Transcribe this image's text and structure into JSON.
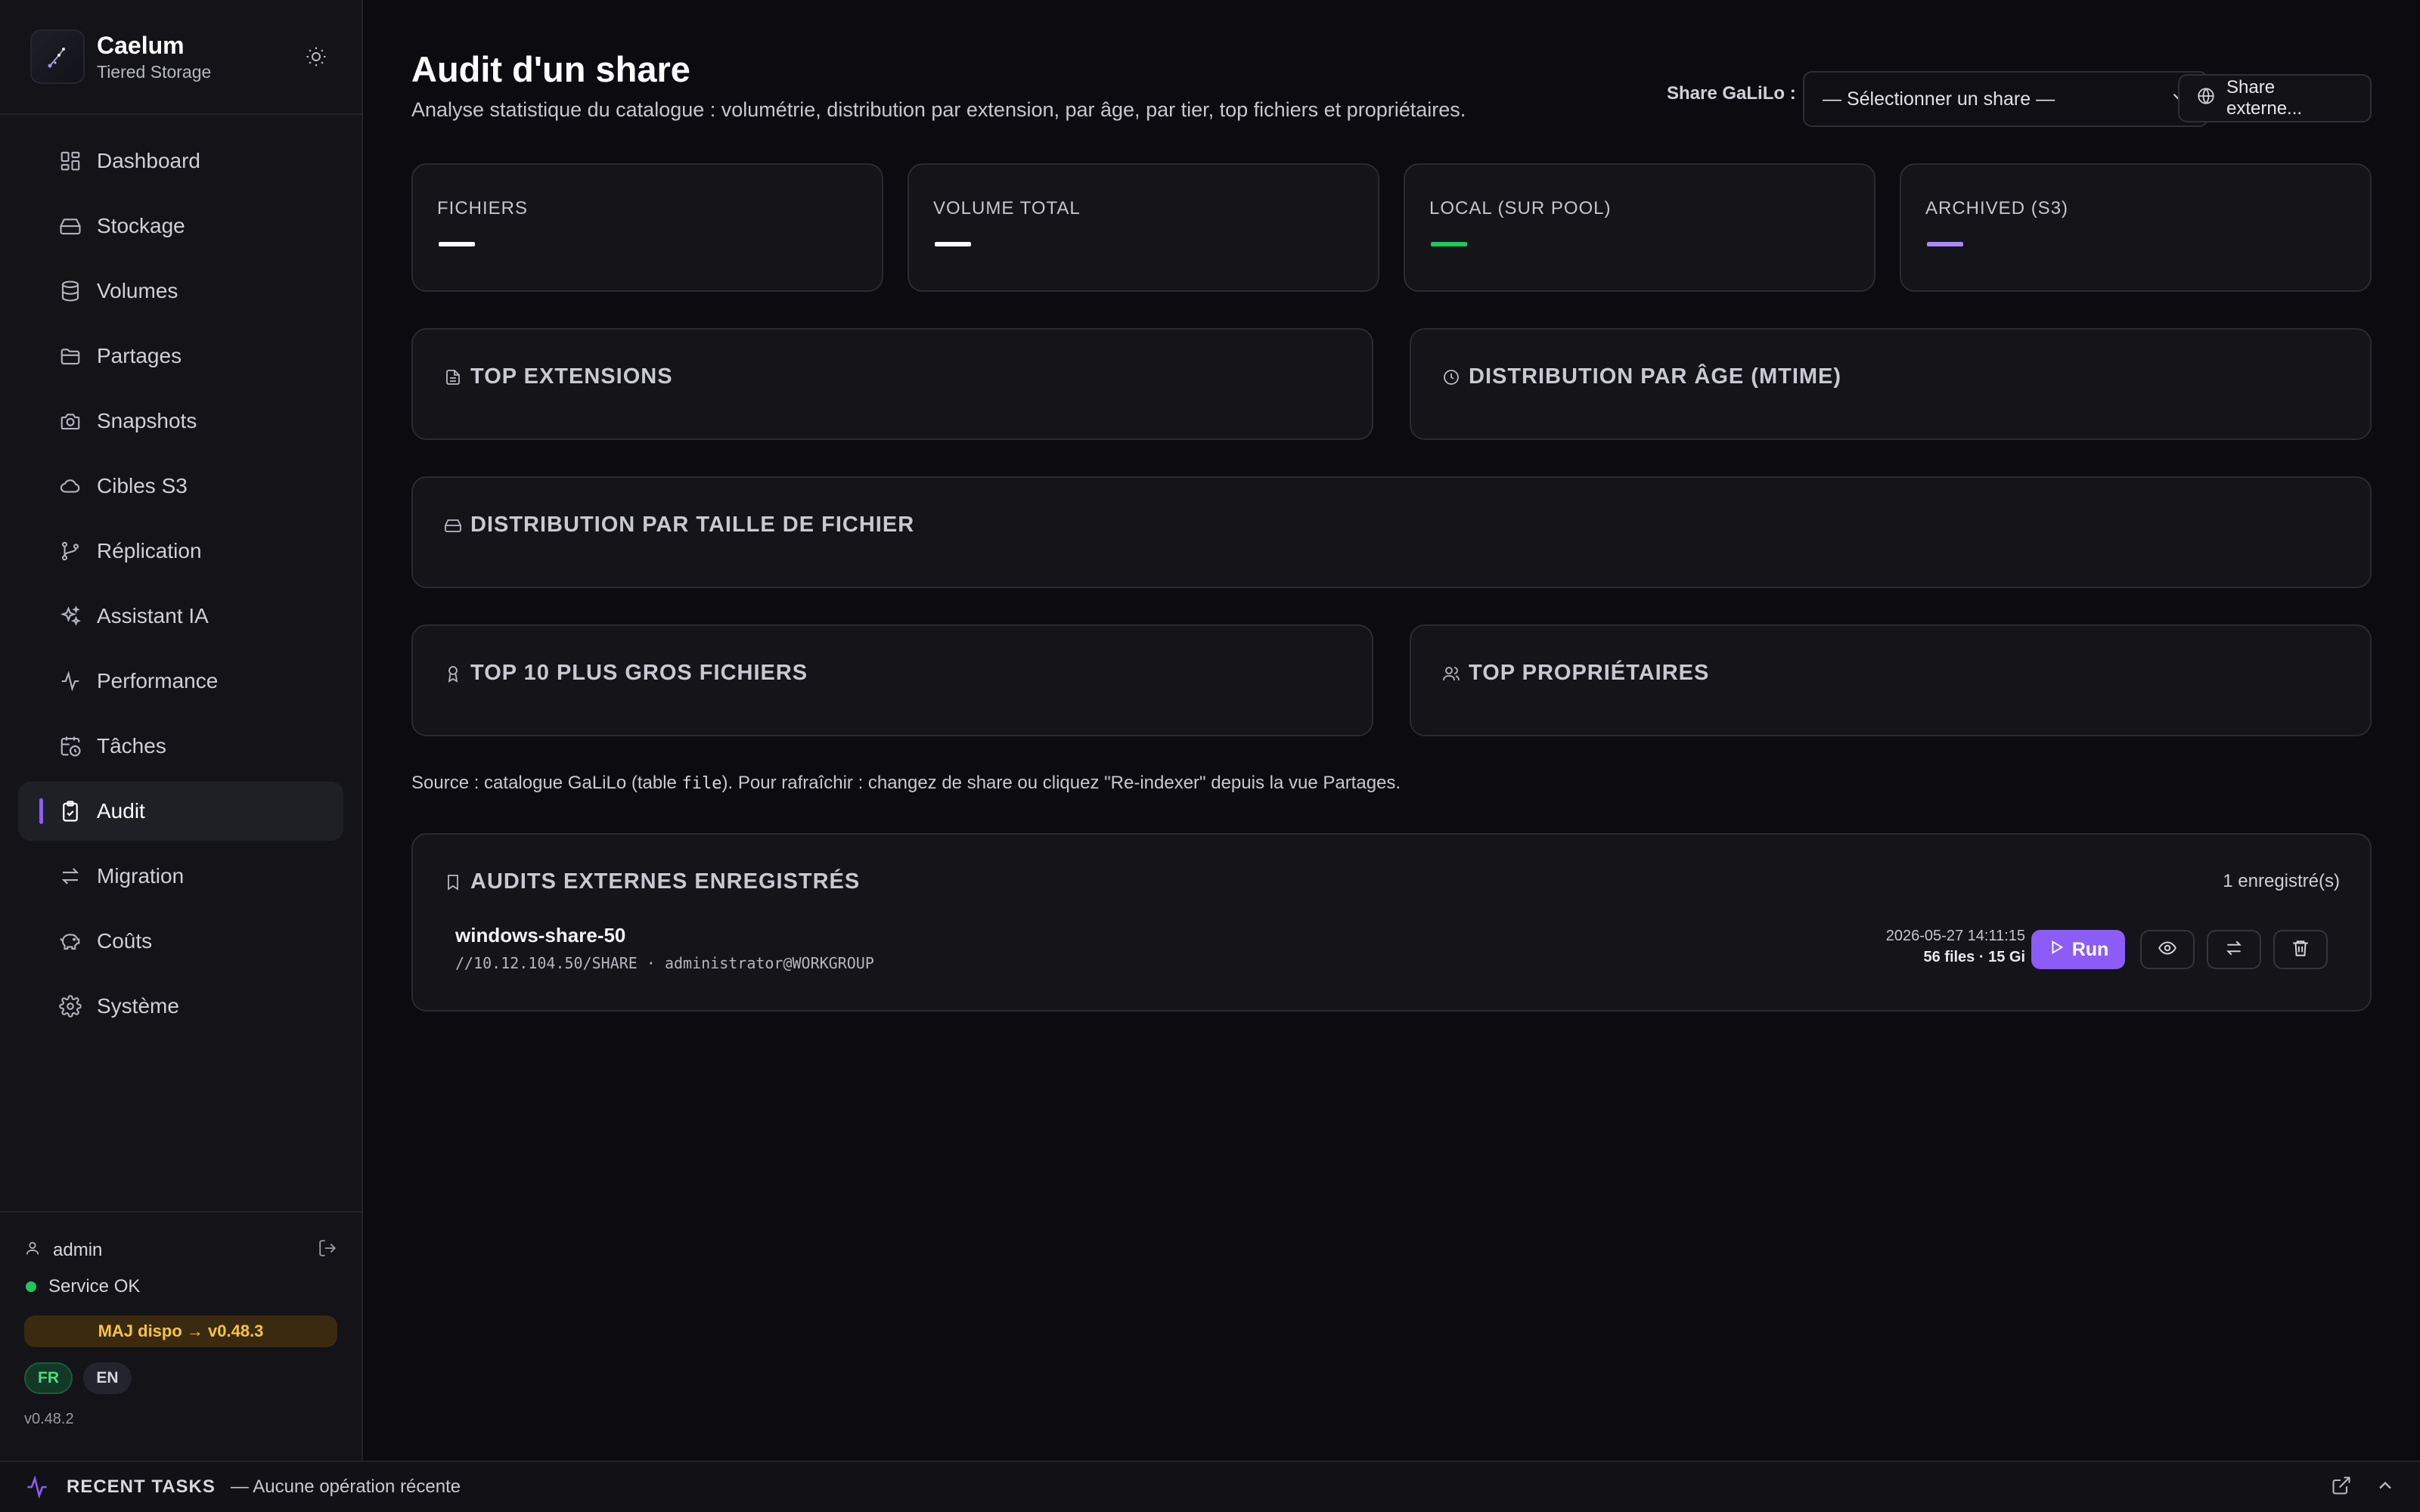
{
  "brand": {
    "title": "Caelum",
    "subtitle": "Tiered Storage"
  },
  "nav": [
    {
      "label": "Dashboard",
      "icon": "dashboard-icon"
    },
    {
      "label": "Stockage",
      "icon": "storage-icon"
    },
    {
      "label": "Volumes",
      "icon": "database-icon"
    },
    {
      "label": "Partages",
      "icon": "folder-icon"
    },
    {
      "label": "Snapshots",
      "icon": "camera-icon"
    },
    {
      "label": "Cibles S3",
      "icon": "cloud-icon"
    },
    {
      "label": "Réplication",
      "icon": "git-branch-icon"
    },
    {
      "label": "Assistant IA",
      "icon": "sparkles-icon"
    },
    {
      "label": "Performance",
      "icon": "activity-icon"
    },
    {
      "label": "Tâches",
      "icon": "calendar-clock-icon"
    },
    {
      "label": "Audit",
      "icon": "clipboard-check-icon",
      "active": true
    },
    {
      "label": "Migration",
      "icon": "arrows-left-right-icon"
    },
    {
      "label": "Coûts",
      "icon": "piggy-bank-icon"
    },
    {
      "label": "Système",
      "icon": "gear-icon"
    }
  ],
  "footer": {
    "user": "admin",
    "service_status": "Service OK",
    "update_label": "MAJ dispo → v0.48.3",
    "lang_fr": "FR",
    "lang_en": "EN",
    "version": "v0.48.2"
  },
  "header": {
    "title": "Audit d'un share",
    "subtitle": "Analyse statistique du catalogue : volumétrie, distribution par extension, par âge, par tier, top fichiers et propriétaires.",
    "share_label": "Share GaLiLo :",
    "share_select": "— Sélectionner un share —",
    "share_external": "Share externe..."
  },
  "stats": [
    {
      "label": "FICHIERS",
      "color": "#ffffff"
    },
    {
      "label": "VOLUME TOTAL",
      "color": "#ffffff"
    },
    {
      "label": "LOCAL (SUR POOL)",
      "color": "#22c55e"
    },
    {
      "label": "ARCHIVED (S3)",
      "color": "#a78bfa"
    }
  ],
  "sections": {
    "top_extensions": "TOP EXTENSIONS",
    "age_distribution": "DISTRIBUTION PAR ÂGE (MTIME)",
    "size_distribution": "DISTRIBUTION PAR TAILLE DE FICHIER",
    "top_files": "TOP 10 PLUS GROS FICHIERS",
    "top_owners": "TOP PROPRIÉTAIRES"
  },
  "source_note": {
    "prefix": "Source : catalogue GaLiLo (table ",
    "code": "file",
    "suffix": "). Pour rafraîchir : changez de share ou cliquez \"Re-indexer\" depuis la vue Partages."
  },
  "external_audits": {
    "title": "AUDITS EXTERNES ENREGISTRÉS",
    "count": "1 enregistré(s)",
    "items": [
      {
        "name": "windows-share-50",
        "path": "//10.12.104.50/SHARE · administrator@WORKGROUP",
        "date": "2026-05-27 14:11:15",
        "summary": "56 files · 15 Gi",
        "run_label": "Run"
      }
    ]
  },
  "bottom_bar": {
    "label": "RECENT TASKS",
    "status": "— Aucune opération récente"
  },
  "colors": {
    "accent": "#8b5cf6",
    "ok": "#22c55e",
    "warning": "#f5c542"
  }
}
